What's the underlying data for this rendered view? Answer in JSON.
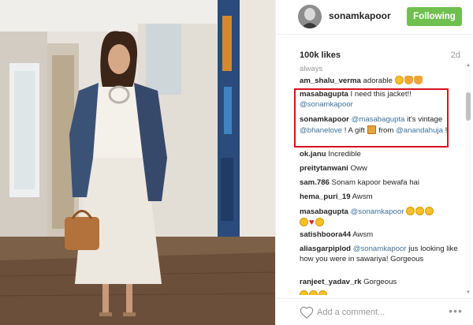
{
  "post": {
    "username": "sonamkapoor",
    "follow_label": "Following",
    "likes": "100k likes",
    "age": "2d"
  },
  "comments": [
    {
      "partial": "always"
    },
    {
      "user": "am_shalu_verma",
      "text": "adorable",
      "emoji": [
        "face",
        "hand",
        "hand"
      ]
    },
    {
      "user": "masabagupta",
      "text": "I need this jacket!!",
      "mention": "@sonamkapoor"
    },
    {
      "user": "sonamkapoor",
      "mention1": "@masabagupta",
      "text1": "it's vintage",
      "mention2": "@bhanelove",
      "text2": "! A gift",
      "text3": "from",
      "mention3": "@anandahuja",
      "text4": "!"
    },
    {
      "user": "ok.janu",
      "text": "Incredible"
    },
    {
      "user": "preitytanwani",
      "text": "Oww"
    },
    {
      "user": "sam.786",
      "text": "Sonam kapoor bewafa hai"
    },
    {
      "user": "hema_puri_19",
      "text": "Awsm"
    },
    {
      "user": "masabagupta",
      "mention": "@sonamkapoor",
      "emoji": [
        "face",
        "face",
        "face",
        "heart",
        "nerd"
      ]
    },
    {
      "user": "satishboora44",
      "text": "Awsm"
    },
    {
      "user": "aliasgarpiplod",
      "mention": "@sonamkapoor",
      "text": "jus looking like how you were in sawariya! Gorgeous"
    },
    {
      "user": "ranjeet_yadav_rk",
      "text": "Gorgeous"
    },
    {
      "partial_emoji": [
        "face",
        "face",
        "face"
      ]
    }
  ],
  "footer": {
    "placeholder": "Add a comment...",
    "more": "•••"
  },
  "colors": {
    "follow": "#70c050",
    "mention": "#3f729b",
    "highlight": "#d7121e"
  }
}
